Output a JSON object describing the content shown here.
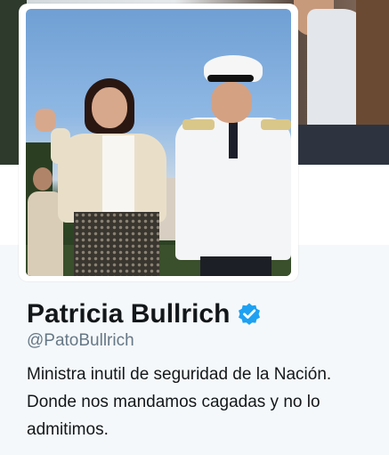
{
  "profile": {
    "display_name": "Patricia Bullrich",
    "handle": "@PatoBullrich",
    "bio_lines": [
      "Ministra inutil de seguridad de la Nación.",
      "Donde nos mandamos cagadas y no lo",
      "admitimos."
    ],
    "verified_icon": "verified-badge-icon"
  },
  "colors": {
    "page_background": "#f5f8fa",
    "text_primary": "#14171a",
    "text_secondary": "#657786",
    "verified_blue": "#1da1f2"
  }
}
